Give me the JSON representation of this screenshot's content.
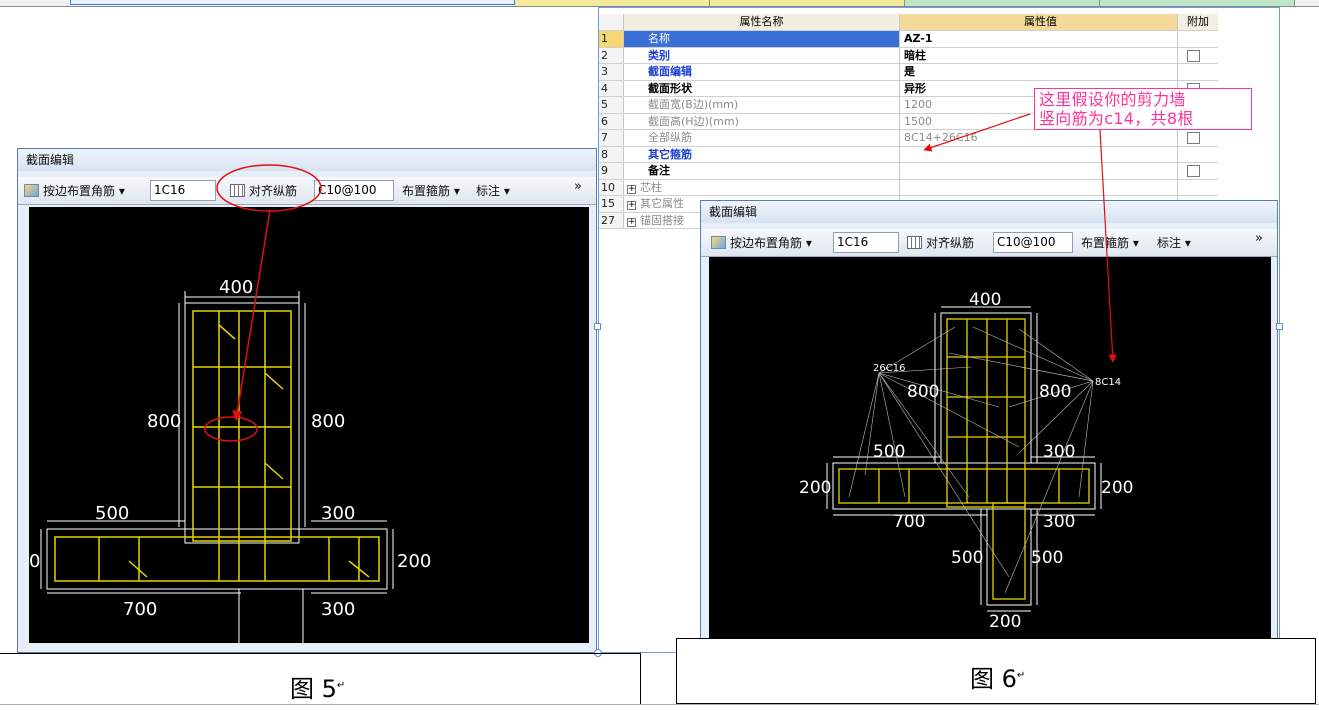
{
  "property_grid": {
    "header_name": "属性名称",
    "header_value": "属性值",
    "header_attach": "附加",
    "rows": [
      {
        "num": "1",
        "name": "名称",
        "value": "AZ-1",
        "name_color": "#1a3fd1",
        "has_check": false,
        "selected": true
      },
      {
        "num": "2",
        "name": "类别",
        "value": "暗柱",
        "name_color": "#1a3fd1",
        "has_check": true
      },
      {
        "num": "3",
        "name": "截面编辑",
        "value": "是",
        "name_color": "#1a3fd1",
        "has_check": false
      },
      {
        "num": "4",
        "name": "截面形状",
        "value": "异形",
        "name_color": "#000000",
        "has_check": true
      },
      {
        "num": "5",
        "name": "截面宽(B边)(mm)",
        "value": "1200",
        "name_color": "#8a8a8a",
        "has_check": true
      },
      {
        "num": "6",
        "name": "截面高(H边)(mm)",
        "value": "1500",
        "name_color": "#8a8a8a",
        "has_check": true
      },
      {
        "num": "7",
        "name": "全部纵筋",
        "value": "8C14+26C16",
        "name_color": "#8a8a8a",
        "has_check": true
      },
      {
        "num": "8",
        "name": "其它箍筋",
        "value": "",
        "name_color": "#1a3fd1",
        "has_check": false
      },
      {
        "num": "9",
        "name": "备注",
        "value": "",
        "name_color": "#000000",
        "has_check": true
      },
      {
        "num": "10",
        "name": "芯柱",
        "value": "",
        "name_color": "#8a8a8a",
        "has_check": false,
        "expandable": true
      },
      {
        "num": "15",
        "name": "其它属性",
        "value": "",
        "name_color": "#8a8a8a",
        "has_check": false,
        "expandable": true
      },
      {
        "num": "27",
        "name": "锚固搭接",
        "value": "",
        "name_color": "#8a8a8a",
        "has_check": false,
        "expandable": true
      }
    ]
  },
  "annotation_callout": {
    "line1": "这里假设你的剪力墙",
    "line2": "竖向筋为c14，共8根",
    "color": "#ff3399"
  },
  "dialog_left": {
    "title": "截面编辑",
    "corner_btn": "按边布置角筋",
    "corner_value": "1C16",
    "align_btn": "对齐纵筋",
    "stirrup_value": "C10@100",
    "layout_btn": "布置箍筋",
    "mark_btn": "标注",
    "more": "»",
    "dims": {
      "top": "400",
      "left_mid": "800",
      "right_mid": "800",
      "left_arm": "500",
      "right_arm": "300",
      "left_edge": "0",
      "right_edge": "200",
      "bottom_left": "700",
      "bottom_right": "300"
    }
  },
  "dialog_right": {
    "title": "截面编辑",
    "corner_btn": "按边布置角筋",
    "corner_value": "1C16",
    "align_btn": "对齐纵筋",
    "stirrup_value": "C10@100",
    "layout_btn": "布置箍筋",
    "mark_btn": "标注",
    "more": "»",
    "dims": {
      "top": "400",
      "left_mid": "800",
      "right_mid": "800",
      "left_arm": "500",
      "right_arm": "300",
      "left_edge": "200",
      "right_edge": "200",
      "bottom_left": "700",
      "bottom_right": "300",
      "stem_left": "500",
      "stem_right": "500",
      "stem_bottom": "200"
    },
    "rebar_label_a": "26C16",
    "rebar_label_b": "8C14"
  },
  "figures": {
    "fig5": "图 5",
    "fig6": "图 6"
  },
  "colors": {
    "rebar": "#e6d400",
    "dim": "#ffffff",
    "arrow": "#e01010",
    "circle": "#e01010"
  }
}
